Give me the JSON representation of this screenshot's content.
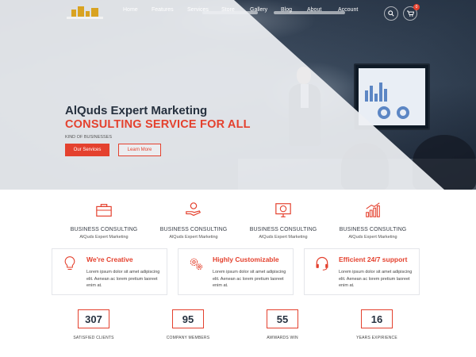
{
  "nav": {
    "items": [
      "Home",
      "Features",
      "Services",
      "Store",
      "Gallery",
      "Blog",
      "About",
      "Account"
    ],
    "search_icon": "🔍",
    "cart_icon": "🛒",
    "cart_count": "0"
  },
  "hero": {
    "title": "AlQuds Expert Marketing",
    "subtitle": "CONSULTING SERVICE FOR ALL",
    "tagline": "KIND OF BUSINESSES",
    "primary_button": "Our Services",
    "secondary_button": "Learn More"
  },
  "services": [
    {
      "title": "BUSINESS CONSULTING",
      "subtitle": "AlQuds Expert Marketing",
      "icon": "briefcase-icon"
    },
    {
      "title": "BUSINESS CONSULTING",
      "subtitle": "AlQuds Expert Marketing",
      "icon": "hand-coin-icon"
    },
    {
      "title": "BUSINESS CONSULTING",
      "subtitle": "AlQuds Expert Marketing",
      "icon": "monitor-dollar-icon"
    },
    {
      "title": "BUSINESS CONSULTING",
      "subtitle": "AlQuds Expert Marketing",
      "icon": "growth-chart-icon"
    }
  ],
  "features": [
    {
      "title": "We're Creative",
      "text": "Lorem ipsum dolor sit amet adipiscing elit. Aenean ac lorem pretium laoreet enim at.",
      "icon": "lightbulb-icon"
    },
    {
      "title": "Highly Customizable",
      "text": "Lorem ipsum dolor sit amet adipiscing elit. Aenean ac lorem pretium laoreet enim at.",
      "icon": "gears-icon"
    },
    {
      "title": "Efficient 24/7 support",
      "text": "Lorem ipsum dolor sit amet adipiscing elit. Aenean ac lorem pretium laoreet enim at.",
      "icon": "headset-icon"
    }
  ],
  "counters": [
    {
      "value": "307",
      "label": "SATISFIED CLIENTS"
    },
    {
      "value": "95",
      "label": "COMPANY MEMBERS"
    },
    {
      "value": "55",
      "label": "AWWARDS WIN"
    },
    {
      "value": "16",
      "label": "YEARS EXPIRIENCE"
    }
  ],
  "colors": {
    "accent": "#e4412e",
    "dark": "#26313f"
  }
}
